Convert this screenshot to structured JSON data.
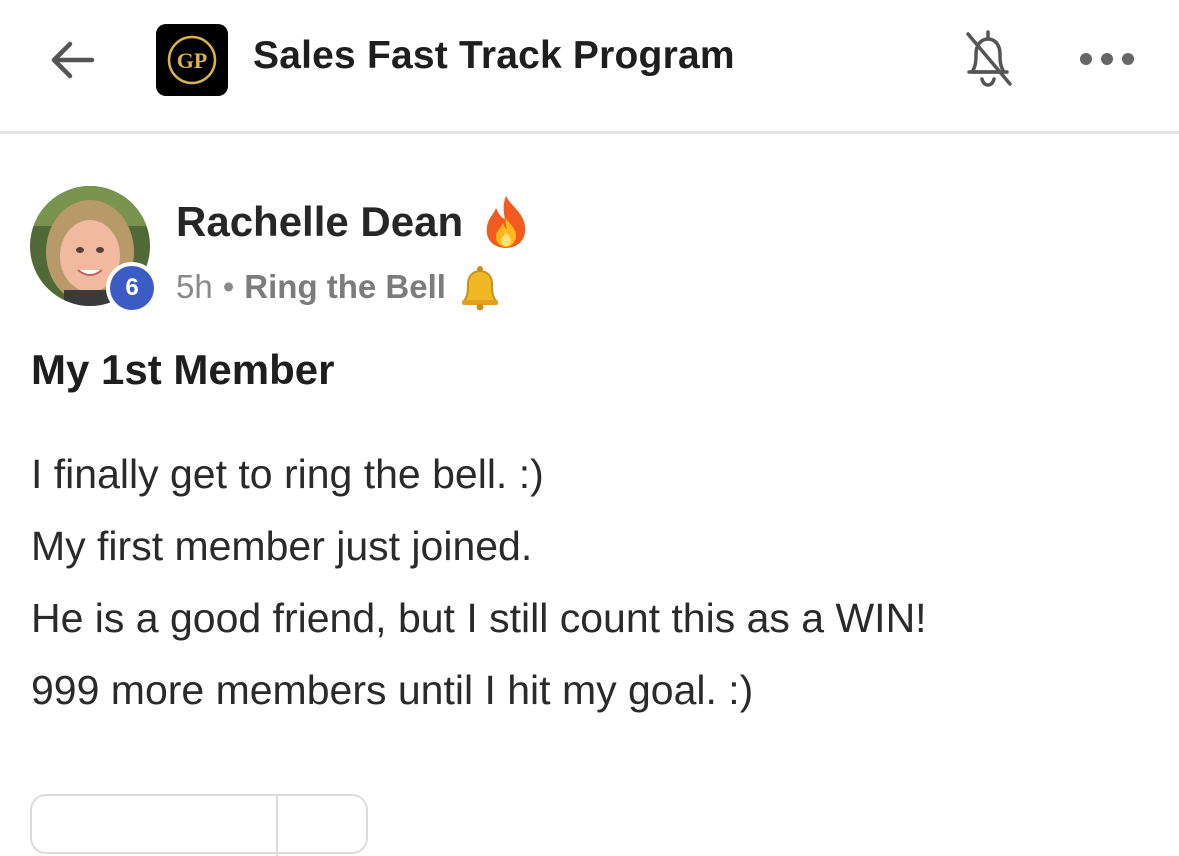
{
  "header": {
    "back_icon": "arrow-left-icon",
    "logo_text": "GP",
    "title": "Sales Fast Track Program",
    "notifications_icon": "bell-off-icon",
    "more_icon": "more-horizontal-icon"
  },
  "post": {
    "author": {
      "name": "Rachelle Dean",
      "level": "6",
      "streak_icon": "fire-icon"
    },
    "meta": {
      "time": "5h",
      "separator": "•",
      "category": "Ring the Bell",
      "category_icon": "bell-icon"
    },
    "title": "My 1st Member",
    "body_lines": [
      "I finally get to ring the bell. :)",
      "My first member just joined.",
      "He is a good friend, but I still count this as a WIN!",
      "999 more members until I hit my goal. :)"
    ]
  },
  "colors": {
    "accent_badge": "#3b5cc4",
    "logo_gold": "#d9b24a",
    "divider": "#e3e3e3"
  }
}
